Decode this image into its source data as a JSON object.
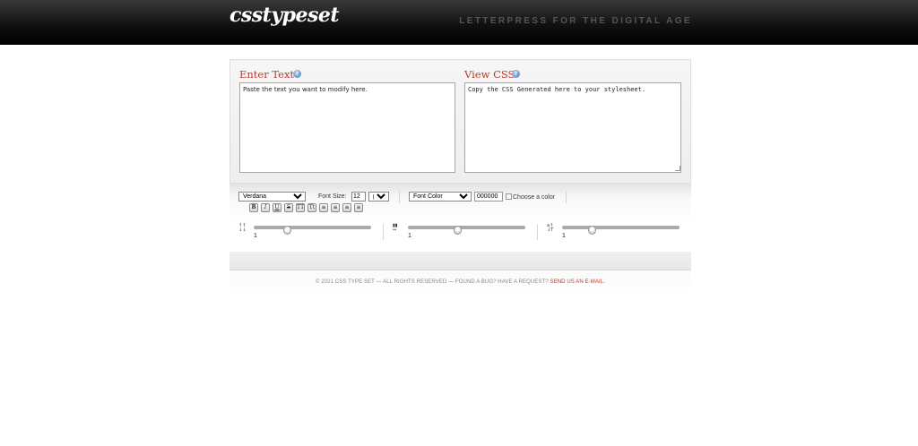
{
  "header": {
    "logo": "csstypeset",
    "tagline": "LETTERPRESS FOR THE DIGITAL AGE"
  },
  "enter_text": {
    "title": "Enter Text",
    "help": "?",
    "value": "Paste the text you want to modify here."
  },
  "view_css": {
    "title": "View CSS",
    "help": "?",
    "value": "Copy the CSS Generated here to your stylesheet."
  },
  "controls": {
    "font_family": "Verdana",
    "font_size_label": "Font Size:",
    "font_size_value": "12",
    "font_unit": "px",
    "font_color_select": "Font Color",
    "color_hex": "000000",
    "choose_color": "Choose a color",
    "format_buttons": [
      "B",
      "I",
      "U",
      "S",
      "TT",
      "Tt",
      "≡",
      "≡",
      "≡",
      "≡"
    ],
    "sliders": [
      {
        "icon": "line-height-icon",
        "value_label": "1",
        "value": 0.28
      },
      {
        "icon": "letter-spacing-icon",
        "value_label": "1",
        "value": 0.42
      },
      {
        "icon": "word-spacing-icon",
        "value_label": "1",
        "value": 0.25
      }
    ]
  },
  "footer": {
    "text": "© 2021 CSS TYPE SET — ALL RIGHTS RESERVED — FOUND A BUG? HAVE A REQUEST?",
    "link": "SEND US AN E-MAIL."
  },
  "colors": {
    "accent": "#c0392b",
    "header_bg": "#000000"
  }
}
